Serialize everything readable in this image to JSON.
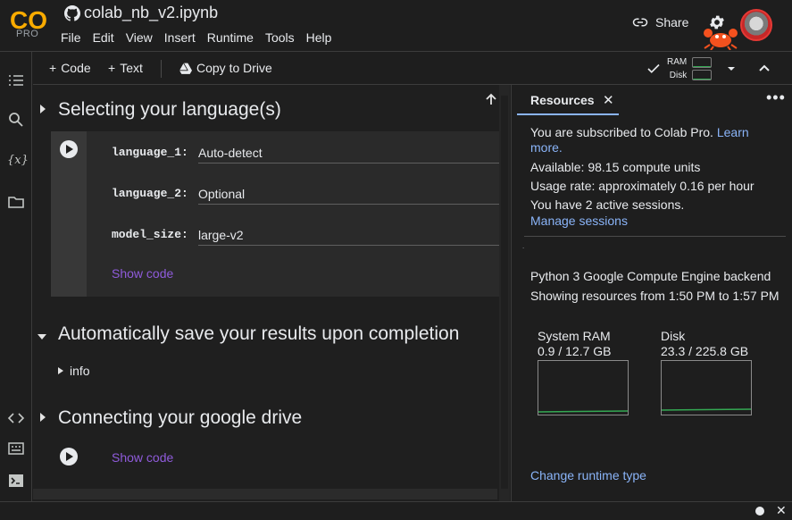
{
  "app": {
    "logo_text": "CO",
    "plan_label": "PRO",
    "notebook_title": "colab_nb_v2.ipynb"
  },
  "menu": [
    "File",
    "Edit",
    "View",
    "Insert",
    "Runtime",
    "Tools",
    "Help"
  ],
  "header": {
    "share_label": "Share"
  },
  "toolbar": {
    "add_code_label": "Code",
    "add_text_label": "Text",
    "copy_drive_label": "Copy to Drive",
    "ram_label": "RAM",
    "disk_label": "Disk",
    "ram_fraction": 0.07,
    "disk_fraction": 0.1
  },
  "notebook": {
    "section1_title": "Selecting your language(s)",
    "params": [
      {
        "label": "language_1:",
        "value": "Auto-detect"
      },
      {
        "label": "language_2:",
        "value": "Optional"
      },
      {
        "label": "model_size:",
        "value": "large-v2"
      }
    ],
    "show_code_label": "Show code",
    "section2_title": "Automatically save your results upon completion",
    "info_label": "info",
    "section3_title": "Connecting your google drive"
  },
  "resources": {
    "tab_label": "Resources",
    "subscribed_text": "You are subscribed to Colab Pro.",
    "learn_more_a": "Learn",
    "learn_more_b": "more.",
    "available": "Available: 98.15 compute units",
    "usage_rate": "Usage rate: approximately 0.16 per hour",
    "sessions": "You have 2 active sessions.",
    "manage_sessions": "Manage sessions",
    "dot": ".",
    "backend": "Python 3 Google Compute Engine backend",
    "showing_range": "Showing resources from 1:50 PM to 1:57 PM",
    "ram_title": "System RAM",
    "ram_value": "0.9 / 12.7 GB",
    "disk_title": "Disk",
    "disk_value": "23.3 / 225.8 GB",
    "change_runtime": "Change runtime type"
  },
  "colors": {
    "accent_link": "#8ab4f8",
    "show_code": "#8f5bdb",
    "usage_line": "#34a853",
    "logo_orange": "#f9ab00"
  },
  "icons": [
    "github-icon",
    "link-icon",
    "gear-icon",
    "avatar",
    "crab-icon",
    "toc-icon",
    "search-icon",
    "variables-icon",
    "folder-icon",
    "code-snippets-icon",
    "command-palette-icon",
    "terminal-icon",
    "drive-icon",
    "check-icon",
    "chevron-down-icon",
    "chevron-up-icon",
    "arrow-up-icon",
    "close-icon",
    "more-icon"
  ]
}
